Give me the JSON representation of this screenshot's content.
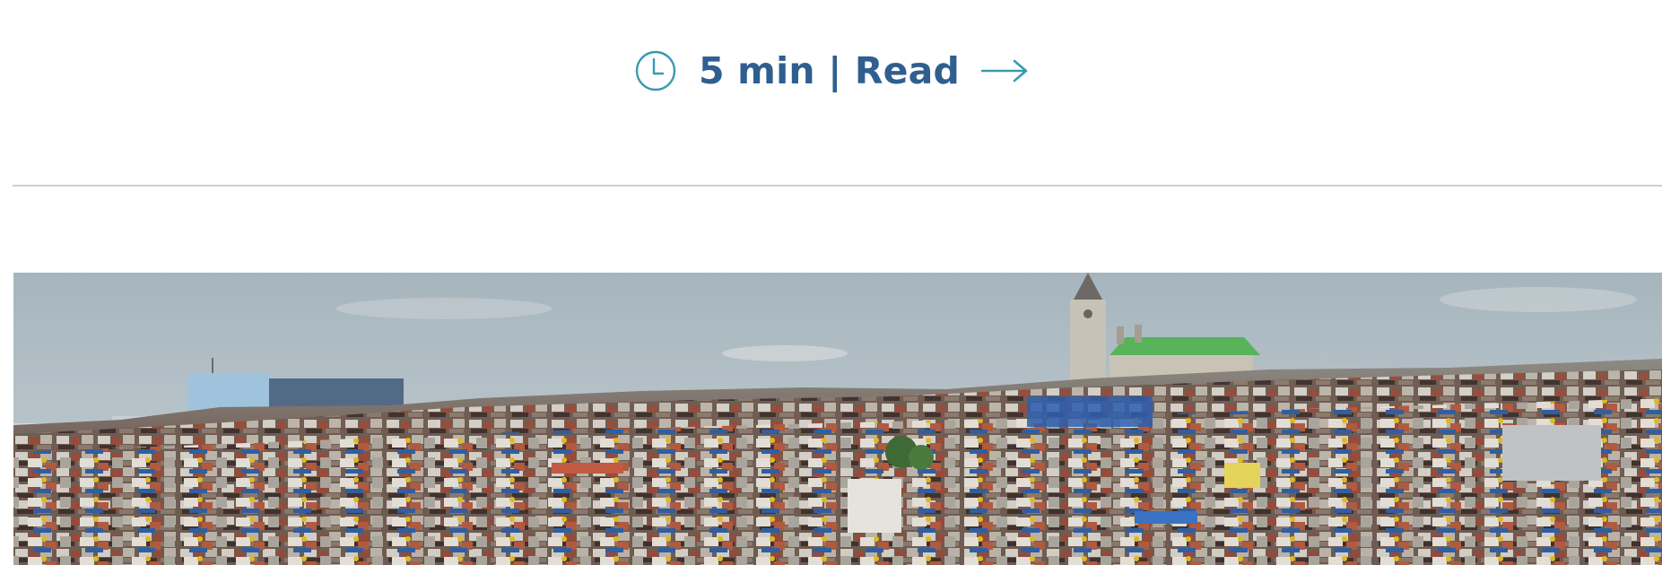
{
  "article": {
    "read_time": "5 min | Read"
  },
  "icons": {
    "clock": "clock-icon",
    "arrow": "arrow-right-icon"
  },
  "colors": {
    "accent": "#3a9ab0",
    "text": "#2f5f8f",
    "divider": "#cfcfcf",
    "sky": "#a8b7bf",
    "church_roof": "#58b35a"
  }
}
